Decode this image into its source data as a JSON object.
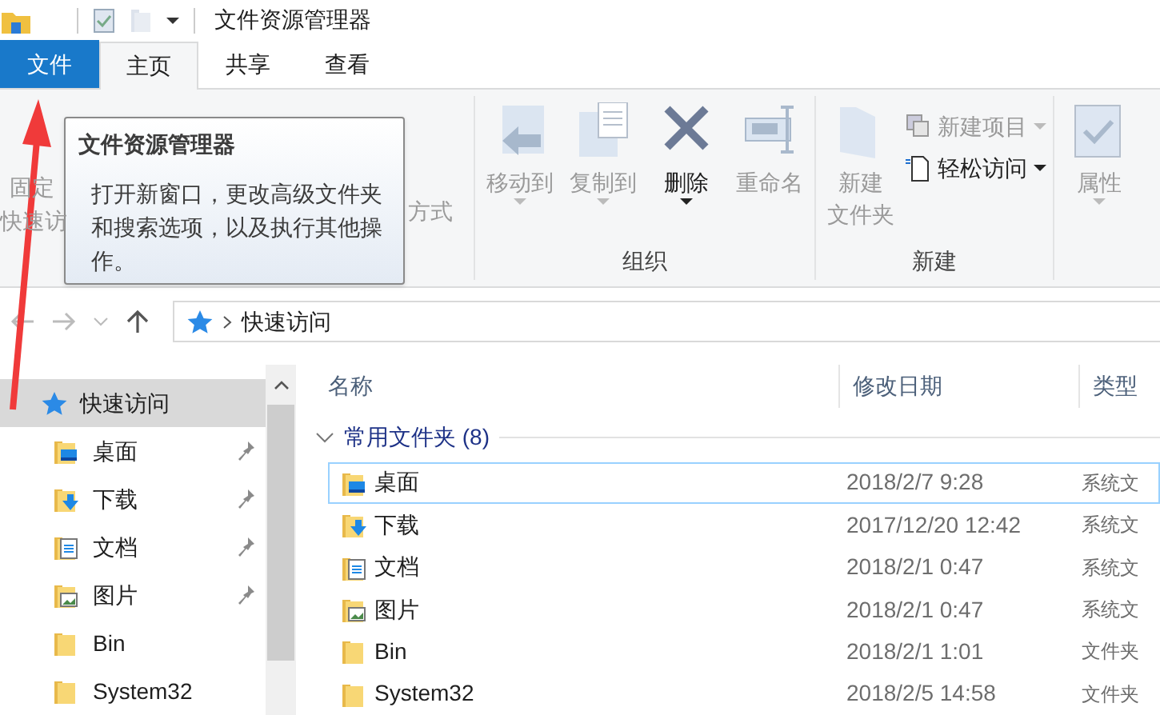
{
  "window": {
    "title": "文件资源管理器"
  },
  "tabs": [
    {
      "label": "文件",
      "kind": "file",
      "selected": false
    },
    {
      "label": "主页",
      "kind": "tab",
      "selected": true
    },
    {
      "label": "共享",
      "kind": "tab",
      "selected": false
    },
    {
      "label": "查看",
      "kind": "tab",
      "selected": false
    }
  ],
  "ribbon": {
    "hidden_fragments": [
      "固定",
      "快速访",
      "方式"
    ],
    "groups": [
      {
        "label": "组织",
        "commands": [
          {
            "label": "移动到",
            "kind": "move",
            "disabled": true,
            "dropdown": true
          },
          {
            "label": "复制到",
            "kind": "copy",
            "disabled": true,
            "dropdown": true
          },
          {
            "label": "删除",
            "kind": "delete",
            "disabled": false,
            "dropdown": true
          },
          {
            "label": "重命名",
            "kind": "rename",
            "disabled": true,
            "dropdown": false
          }
        ]
      },
      {
        "label": "新建",
        "commands": [
          {
            "label_lines": [
              "新建",
              "文件夹"
            ],
            "kind": "newfolder",
            "disabled": true,
            "dropdown": false
          },
          {
            "label": "新建项目",
            "kind": "newitem",
            "disabled": true,
            "dropdown": true
          },
          {
            "label": "轻松访问",
            "kind": "easy",
            "disabled": false,
            "dropdown": true
          }
        ]
      },
      {
        "commands": [
          {
            "label": "属性",
            "kind": "props",
            "disabled": true,
            "dropdown": true
          }
        ]
      }
    ]
  },
  "tooltip": {
    "title": "文件资源管理器",
    "text": "打开新窗口，更改高级文件夹和搜索选项，以及执行其他操作。"
  },
  "address": {
    "path": [
      "快速访问"
    ]
  },
  "nav": {
    "items": [
      {
        "label": "快速访问",
        "kind": "star",
        "selected": true,
        "pinned": false,
        "children": [
          {
            "label": "桌面",
            "kind": "desktop",
            "selected": false,
            "pinned": true
          },
          {
            "label": "下载",
            "kind": "download",
            "selected": false,
            "pinned": true
          },
          {
            "label": "文档",
            "kind": "document",
            "selected": false,
            "pinned": true
          },
          {
            "label": "图片",
            "kind": "picture",
            "selected": false,
            "pinned": true
          },
          {
            "label": "Bin",
            "kind": "folder",
            "selected": false,
            "pinned": false
          },
          {
            "label": "System32",
            "kind": "folder",
            "selected": false,
            "pinned": false
          }
        ]
      }
    ]
  },
  "table": {
    "columns": [
      "名称",
      "修改日期",
      "类型"
    ],
    "group": {
      "label": "常用文件夹 (8)",
      "expanded": true
    },
    "rows": [
      {
        "name": "桌面",
        "kind": "desktop",
        "modified": "2018/2/7 9:28",
        "type": "系统文",
        "focused": true
      },
      {
        "name": "下载",
        "kind": "download",
        "modified": "2017/12/20 12:42",
        "type": "系统文",
        "focused": false
      },
      {
        "name": "文档",
        "kind": "document",
        "modified": "2018/2/1 0:47",
        "type": "系统文",
        "focused": false
      },
      {
        "name": "图片",
        "kind": "picture",
        "modified": "2018/2/1 0:47",
        "type": "系统文",
        "focused": false
      },
      {
        "name": "Bin",
        "kind": "folder",
        "modified": "2018/2/1 1:01",
        "type": "文件夹",
        "focused": false
      },
      {
        "name": "System32",
        "kind": "folder",
        "modified": "2018/2/5 14:58",
        "type": "文件夹",
        "focused": false
      }
    ]
  }
}
